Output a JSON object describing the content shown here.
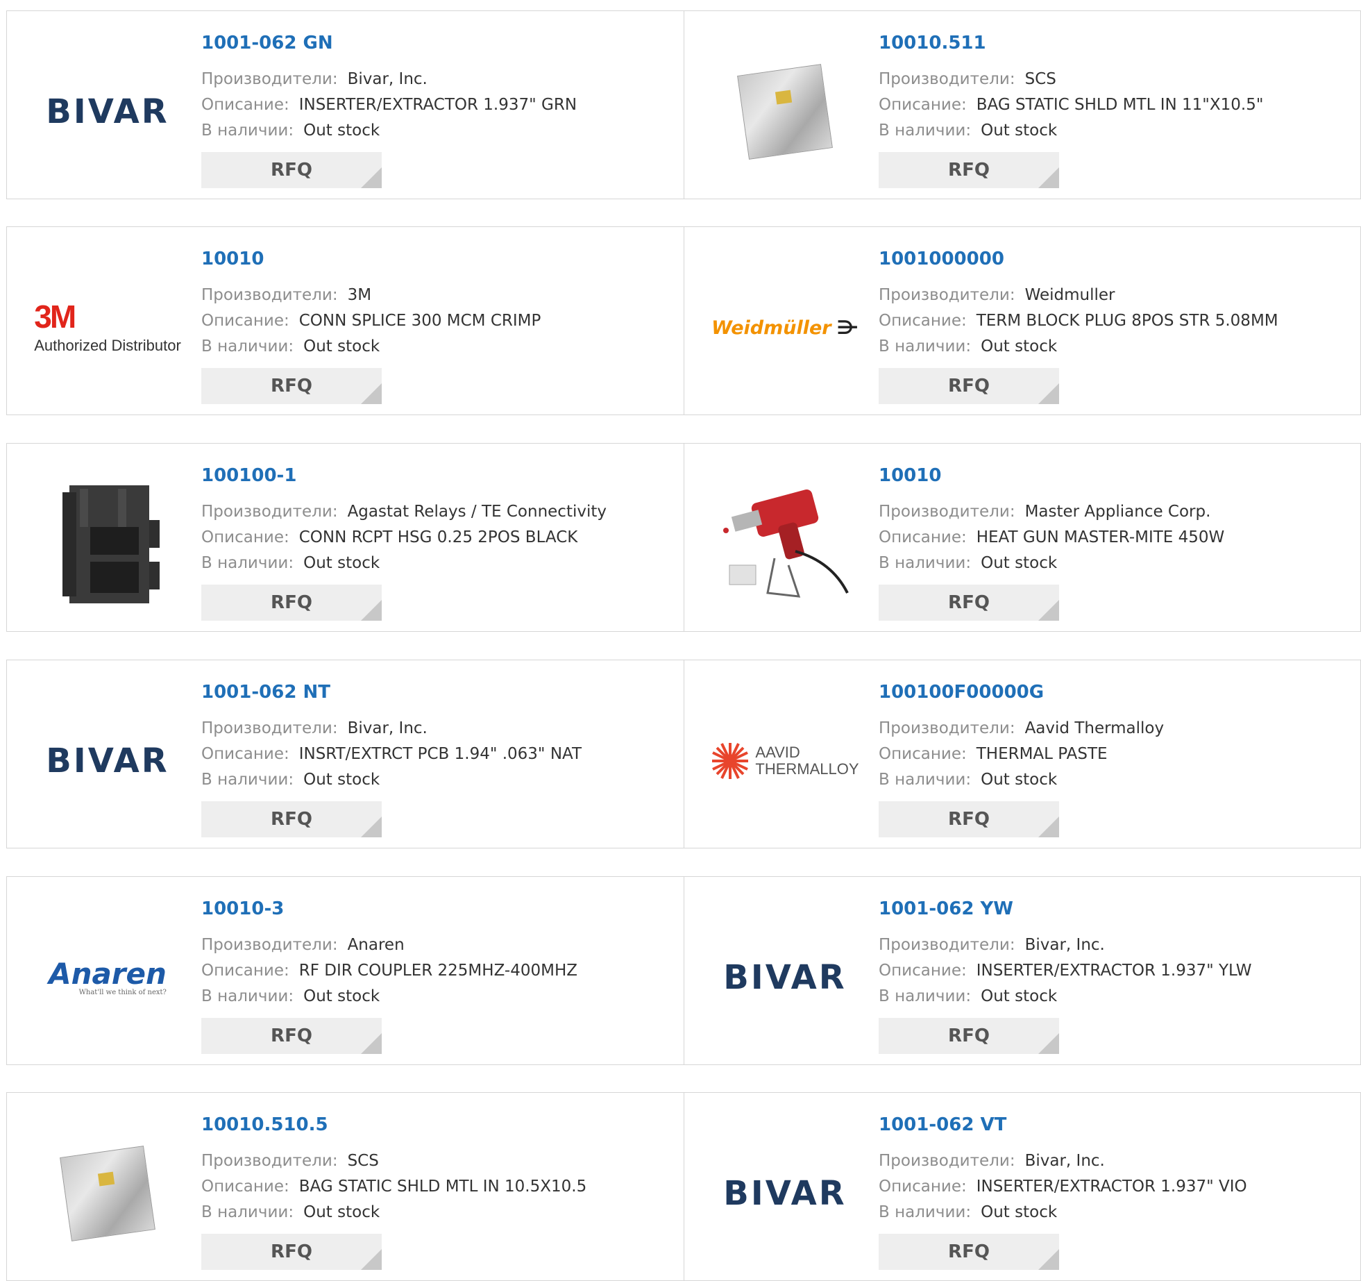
{
  "labels": {
    "manufacturer": "Производители:",
    "description": "Описание:",
    "availability": "В наличии:",
    "rfq": "RFQ"
  },
  "logos": {
    "bivar": "BIVAR",
    "m3_big": "3M",
    "m3_sub": "Authorized Distributor",
    "weidmuller": "Weidmüller",
    "weidmuller_mark": "⋺",
    "aavid_1": "AAVID",
    "aavid_2": "THERMALLOY",
    "anaren": "Anaren",
    "anaren_tag": "What'll we think of next?"
  },
  "rows": [
    [
      {
        "part": "1001-062 GN",
        "manufacturer": "Bivar, Inc.",
        "description": "INSERTER/EXTRACTOR 1.937\" GRN",
        "stock": "Out stock",
        "image": "bivar"
      },
      {
        "part": "10010.511",
        "manufacturer": "SCS",
        "description": "BAG STATIC SHLD MTL IN 11\"X10.5\"",
        "stock": "Out stock",
        "image": "static-bag"
      }
    ],
    [
      {
        "part": "10010",
        "manufacturer": "3M",
        "description": "CONN SPLICE 300 MCM CRIMP",
        "stock": "Out stock",
        "image": "3m"
      },
      {
        "part": "1001000000",
        "manufacturer": "Weidmuller",
        "description": "TERM BLOCK PLUG 8POS STR 5.08MM",
        "stock": "Out stock",
        "image": "weidmuller"
      }
    ],
    [
      {
        "part": "100100-1",
        "manufacturer": "Agastat Relays / TE Connectivity",
        "description": "CONN RCPT HSG 0.25 2POS BLACK",
        "stock": "Out stock",
        "image": "connector"
      },
      {
        "part": "10010",
        "manufacturer": "Master Appliance Corp.",
        "description": "HEAT GUN MASTER-MITE 450W",
        "stock": "Out stock",
        "image": "heat-gun"
      }
    ],
    [
      {
        "part": "1001-062 NT",
        "manufacturer": "Bivar, Inc.",
        "description": "INSRT/EXTRCT PCB 1.94\" .063\" NAT",
        "stock": "Out stock",
        "image": "bivar"
      },
      {
        "part": "100100F00000G",
        "manufacturer": "Aavid Thermalloy",
        "description": "THERMAL PASTE",
        "stock": "Out stock",
        "image": "aavid"
      }
    ],
    [
      {
        "part": "10010-3",
        "manufacturer": "Anaren",
        "description": "RF DIR COUPLER 225MHZ-400MHZ",
        "stock": "Out stock",
        "image": "anaren"
      },
      {
        "part": "1001-062 YW",
        "manufacturer": "Bivar, Inc.",
        "description": "INSERTER/EXTRACTOR 1.937\" YLW",
        "stock": "Out stock",
        "image": "bivar"
      }
    ],
    [
      {
        "part": "10010.510.5",
        "manufacturer": "SCS",
        "description": "BAG STATIC SHLD MTL IN 10.5X10.5",
        "stock": "Out stock",
        "image": "static-bag"
      },
      {
        "part": "1001-062 VT",
        "manufacturer": "Bivar, Inc.",
        "description": "INSERTER/EXTRACTOR 1.937\" VIO",
        "stock": "Out stock",
        "image": "bivar"
      }
    ]
  ]
}
